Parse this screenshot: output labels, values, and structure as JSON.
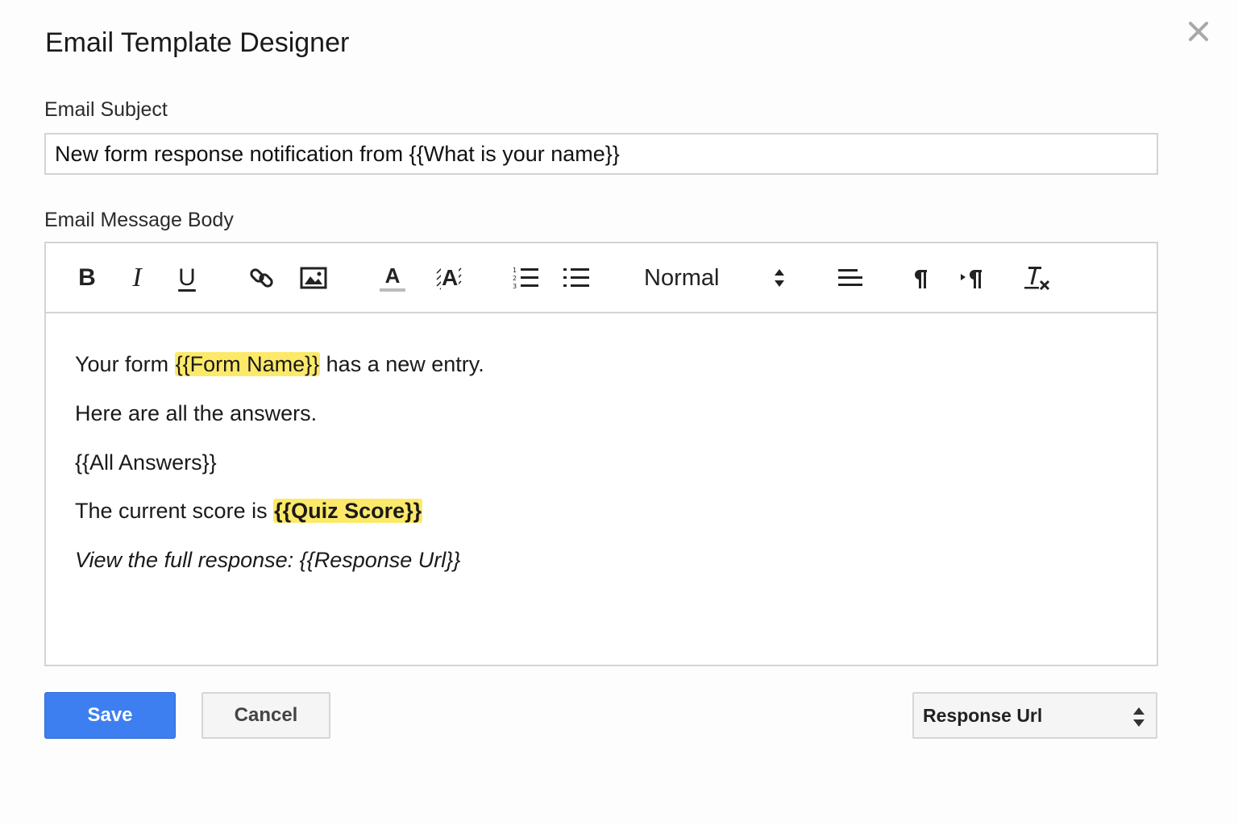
{
  "dialog": {
    "title": "Email Template Designer"
  },
  "subject": {
    "label": "Email Subject",
    "value": "New form response notification from {{What is your name}}"
  },
  "body": {
    "label": "Email Message Body",
    "toolbar": {
      "items": [
        "bold-icon",
        "italic-icon",
        "underline-icon",
        "link-icon",
        "image-icon",
        "text-color-icon",
        "background-color-icon",
        "ordered-list-icon",
        "bullet-list-icon",
        "align-icon",
        "ltr-direction-icon",
        "rtl-direction-icon",
        "clear-formatting-icon"
      ],
      "bold_glyph": "B",
      "italic_glyph": "I",
      "underline_glyph": "U",
      "text_color_glyph": "A",
      "background_color_glyph": "A",
      "format": "Normal"
    },
    "lines": {
      "line1_prefix": "Your form ",
      "line1_tag": "{{Form Name}}",
      "line1_suffix": " has a new entry.",
      "line2": "Here are all the answers.",
      "line3": "{{All Answers}}",
      "line4_prefix": "The current score is ",
      "line4_tag": "{{Quiz Score}}",
      "line5": "View the full response: {{Response Url}}"
    },
    "highlight_color": "#fce96a"
  },
  "actions": {
    "save_label": "Save",
    "cancel_label": "Cancel",
    "save_color": "#3d7ff0"
  },
  "field_picker": {
    "selected": "Response Url"
  }
}
